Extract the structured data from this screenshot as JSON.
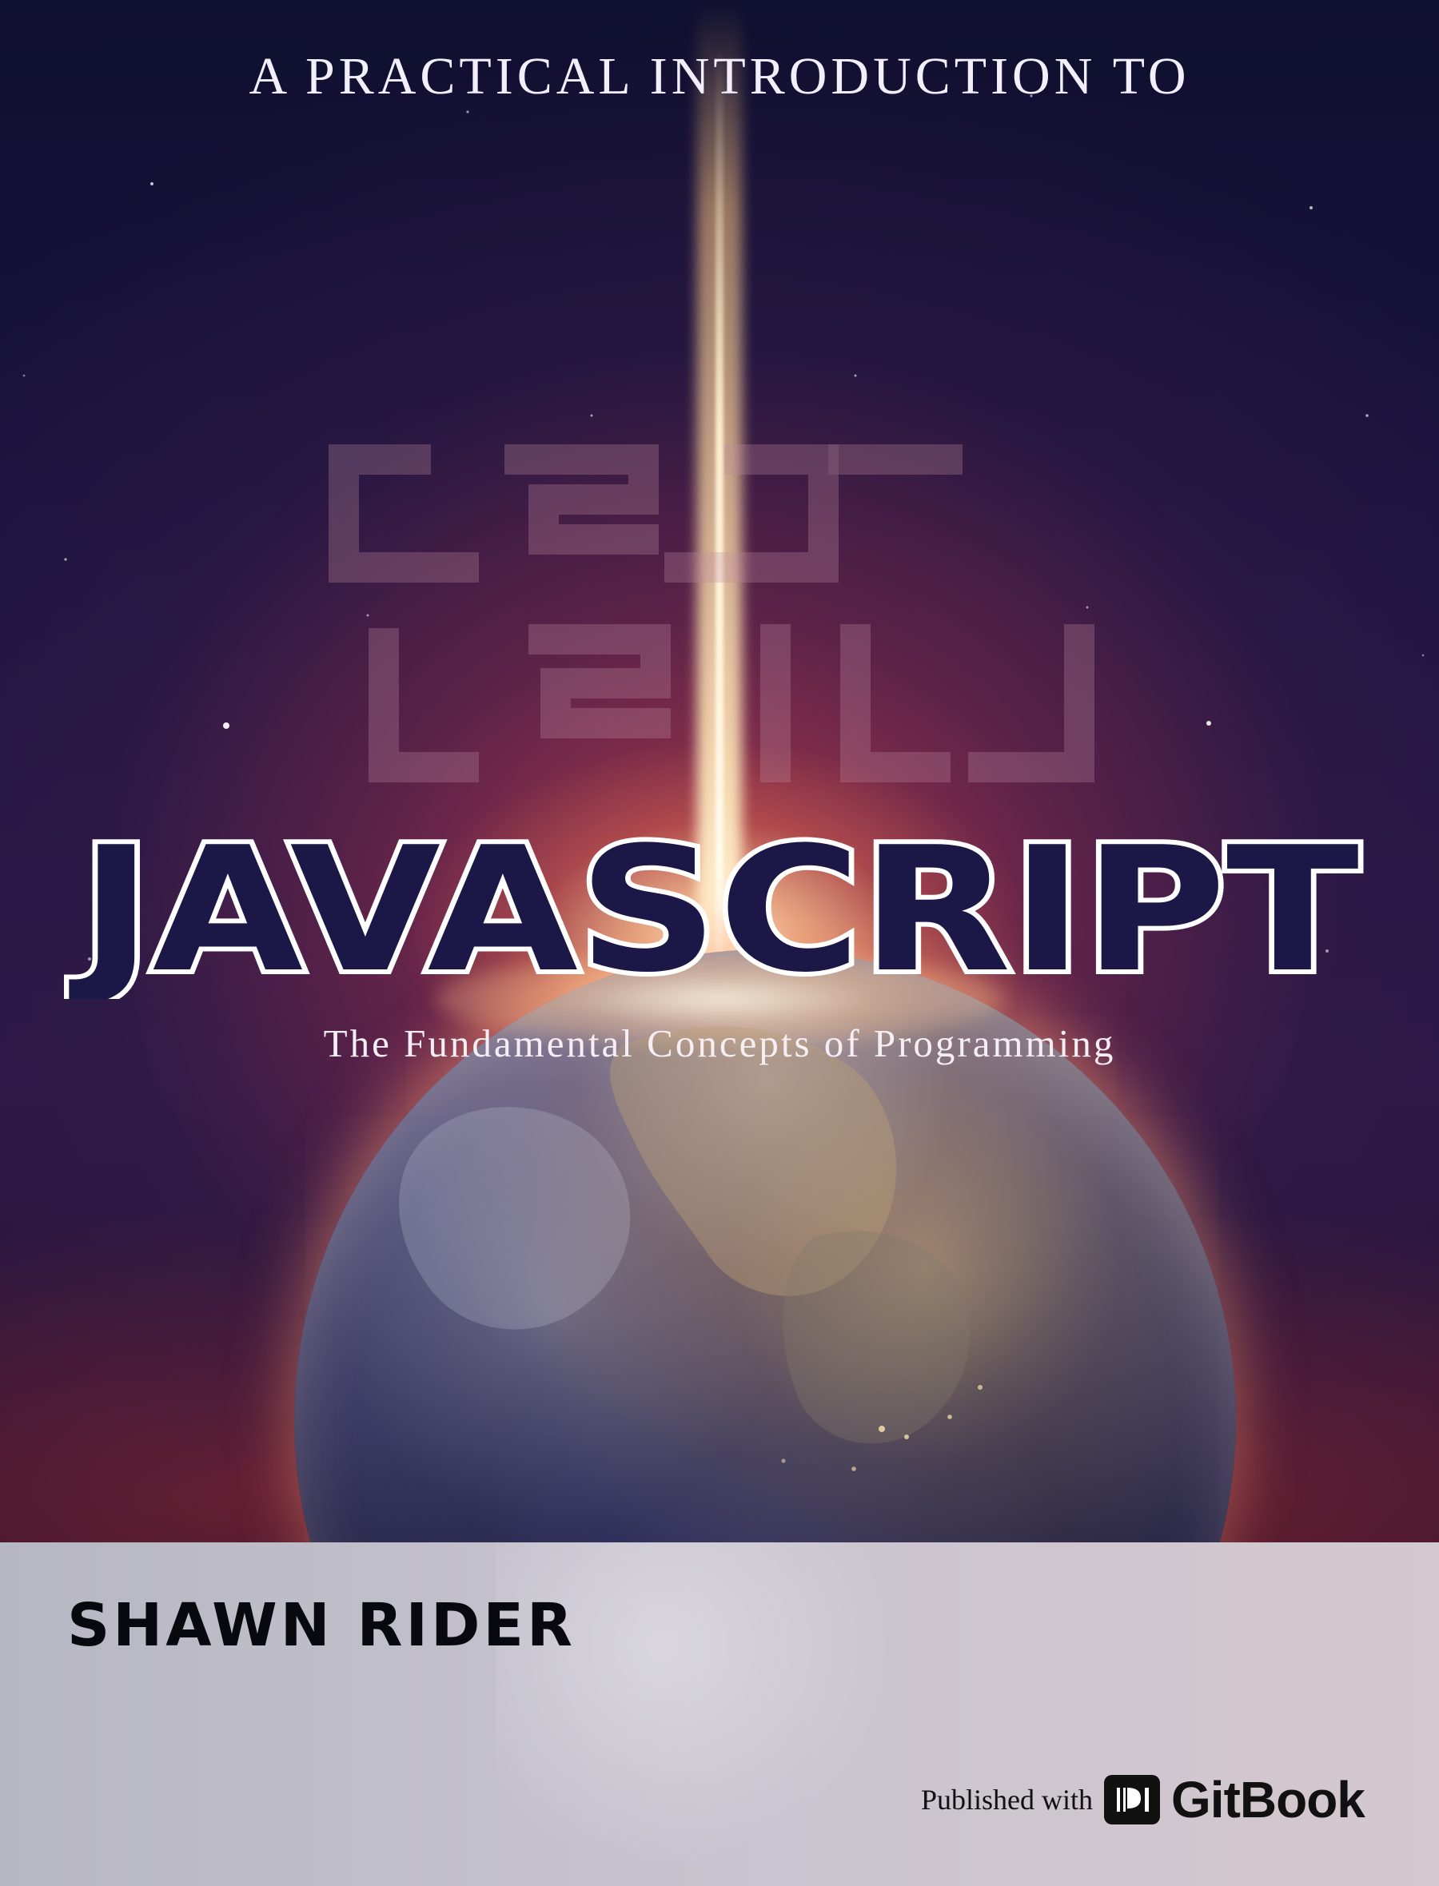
{
  "cover": {
    "series_title": "A PRACTICAL INTRODUCTION TO",
    "main_title": "JAVASCRIPT",
    "watermark_text": "JSJS",
    "subtitle": "The Fundamental Concepts of Programming"
  },
  "author": {
    "name": "SHAWN RIDER"
  },
  "publisher": {
    "label": "Published with",
    "brand": "GitBook"
  },
  "colors": {
    "title_fill": "#1b1747",
    "title_stroke": "#ffffff",
    "band": "#c1bec9",
    "text_dark": "#08080f",
    "text_light": "#f2eefb"
  },
  "icons": {
    "publisher_icon": "gitbook-logo-icon"
  }
}
